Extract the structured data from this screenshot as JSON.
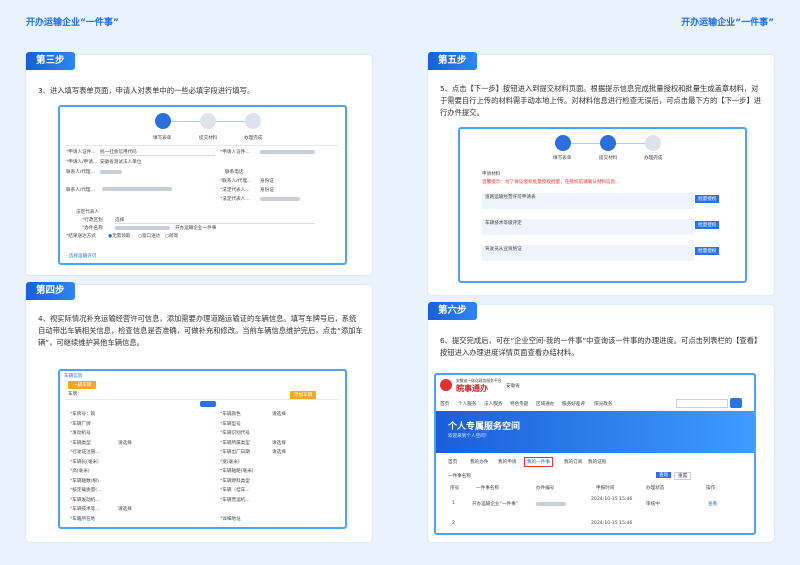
{
  "header": {
    "left_title": "开办运输企业“一件事”",
    "right_title": "开办运输企业“一件事”"
  },
  "steps": [
    {
      "label": "第三步",
      "desc": "3、进入填写表单页面，申请人对表单中的一些必填字段进行填写。"
    },
    {
      "label": "第四步",
      "desc": "4、视实际情况补充运输经营许可信息，添加需要办理道路运输证的车辆信息。填写车牌号后，系统自动带出车辆相关信息，检查信息是否准确，可做补充和修改。当前车辆信息维护完后，点击“添加车辆”，可继续维护其他车辆信息。"
    },
    {
      "label": "第五步",
      "desc": "5、点击【下一步】按钮进入到提交材料页面。根据提示信息完成批量授权和批量生成盖章材料，对于需要自行上传的材料需手动本地上传。对材料信息进行检查无误后，可点击最下方的【下一步】进行办件提交。"
    },
    {
      "label": "第六步",
      "desc": "6、提交完成后，可在“企业空间-我的一件事”中查询该一件事的办理进度。可点击列表栏的【查看】按钮进入办理进度详情页面查看办结材料。"
    }
  ],
  "form3": {
    "progress": [
      "填写表单",
      "提交材料",
      "办理完成"
    ],
    "fields": [
      "申请人证件...",
      "统一社会信用代码",
      "申请人证件...",
      "申请人/申请...",
      "安徽省测试法人单位",
      "联系人/代理...",
      "联系电话",
      "联系人/代理...",
      "身份证",
      "联系人/代理...",
      "法定代表人...",
      "身份证",
      "法定代表人...",
      "法定代表人",
      "行政区划",
      "选择",
      "办件名称",
      "开办运输企业一件事",
      "结果送达方式",
      "无需领取",
      "窗口送达",
      "邮寄"
    ],
    "footer": "· 选择运输许可"
  },
  "form4": {
    "section": "车辆信息",
    "add_btn": "添加车辆",
    "plate_label": "车牌：",
    "tab": "一辆车辆",
    "fields": [
      "车牌号：皖",
      "车辆颜色",
      "请选择",
      "车辆厂牌",
      "车辆型号",
      "发动机号",
      "车辆识别代号",
      "车辆类型",
      "请选择",
      "车辆所属类型",
      "请选择",
      "行驶证注册...",
      "车辆出厂日期",
      "请选择",
      "车辆长(毫米)",
      "宽(毫米)",
      "高(毫米)",
      "车辆轴距(毫米)",
      "车辆轴数(根)",
      "车辆燃料类型",
      "核定载质量(...",
      "车辆（挂车...",
      "车辆发动机...",
      "车辆营运机...",
      "车辆技术等...",
      "请选择",
      "车籍所在地",
      "详细地址"
    ]
  },
  "form5": {
    "progress": [
      "填写表单",
      "提交材料",
      "办理完成"
    ],
    "title": "申请材料",
    "notice": "温馨提示：为了保证授权批量授权批量，在授权前请确认材料信息...",
    "items": [
      "道路运输经营许可申请表",
      "车辆技术等级评定",
      "驾驶员从业资格证"
    ],
    "btn_label": "批量授权"
  },
  "portal": {
    "logo_name": "皖事通办",
    "logo_sub": "安徽省一体化政务服务平台",
    "region": "安徽省",
    "nav": [
      "首页",
      "个人服务",
      "法人服务",
      "特色专题",
      "区域通办",
      "服务好差评",
      "阳光政务"
    ],
    "banner_title": "个人专属服务空间",
    "banner_sub": "欢迎来到个人空间！",
    "tabs": [
      "首页",
      "我的办件",
      "我的申请",
      "我的一件事",
      "我的订阅",
      "我的证照"
    ],
    "active_tab": "我的一件事",
    "table_headers": [
      "序号",
      "一件事名称",
      "办件编号",
      "申报时间",
      "办理状态",
      "操作"
    ],
    "rows": [
      {
        "no": "1",
        "name": "开办运输企业“一件事”",
        "time": "2024-10-15 15:46",
        "status": "审核中",
        "action": "查看"
      },
      {
        "no": "2",
        "name": "",
        "time": "2024-10-15 15:46",
        "status": "",
        "action": ""
      }
    ],
    "search_label": "一件事名称",
    "query_btn": "查询",
    "reset_btn": "重置"
  },
  "colors": {
    "brand": "#1e6ee8",
    "frame": "#4aa3f5",
    "bg": "#eaf3fc"
  }
}
